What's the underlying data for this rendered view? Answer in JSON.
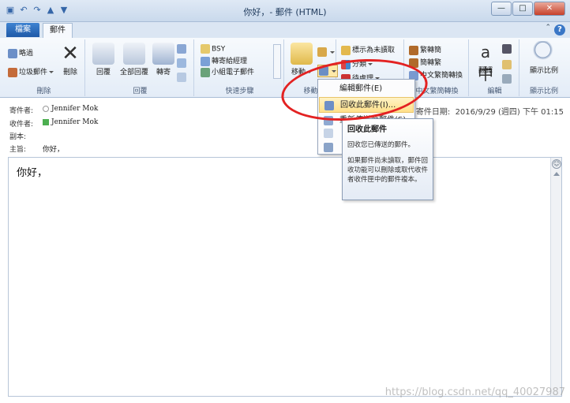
{
  "window": {
    "title": "你好，- 郵件 (HTML)",
    "min": "—",
    "max": "□",
    "close": "✕"
  },
  "tabs": {
    "file": "檔案",
    "mail": "郵件",
    "minimize": "⌃",
    "help": "?"
  },
  "ribbon": {
    "delete_group": {
      "junk": "略過",
      "junk2": "垃圾郵件",
      "delete": "刪除",
      "label": "刪除"
    },
    "respond_group": {
      "reply": "回覆",
      "reply_all": "全部回覆",
      "forward": "轉寄",
      "label": "回覆"
    },
    "quicksteps": {
      "items": [
        "BSY",
        "轉寄給經理",
        "小組電子郵件"
      ],
      "label": "快速步驟"
    },
    "move_group": {
      "move": "移動",
      "label": "移動"
    },
    "tags": {
      "unread": "標示為未讀取",
      "categorize": "分類",
      "followup": "待處理"
    },
    "chinese": {
      "to_trad": "繁轉簡",
      "to_simp": "簡轉繁",
      "convert": "中文繁簡轉換",
      "label": "中文繁簡轉換"
    },
    "editing": {
      "translate": "翻譯",
      "label": "編輯"
    },
    "zoom": {
      "zoom": "顯示比例",
      "label": "顯示比例"
    }
  },
  "header": {
    "from_label": "寄件者:",
    "from_value": "Jennifer Mok",
    "to_label": "收件者:",
    "to_value": "Jennifer Mok",
    "cc_label": "副本:",
    "subject_label": "主旨:",
    "subject_value": "你好，",
    "sent_label": "寄件日期:",
    "sent_value": "2016/9/29 (週四) 下午 01:15"
  },
  "menu": {
    "items": [
      "編輯郵件(E)",
      "回收此郵件(I)...",
      "重新傳送此郵件(S)...",
      "",
      ""
    ]
  },
  "tooltip": {
    "title": "回收此郵件",
    "line1": "回收您已傳送的郵件。",
    "line2": "如果郵件尚未讀取，郵件回收功能可以刪除或取代收件者收件匣中的郵件複本。"
  },
  "body": {
    "text": "你好，"
  },
  "watermark": "https://blog.csdn.net/qq_40027987"
}
